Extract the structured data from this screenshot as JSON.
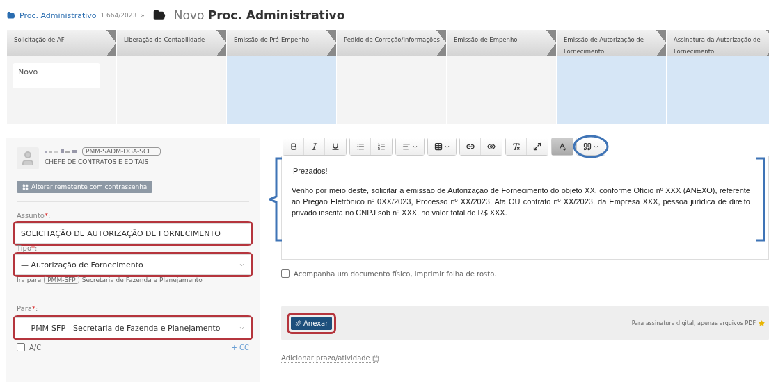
{
  "breadcrumb": {
    "link": "Proc. Administrativo",
    "number": "1.664/2023",
    "separator": "»"
  },
  "title": {
    "prefix": "Novo",
    "main": "Proc. Administrativo"
  },
  "stages": [
    {
      "label": "Solicitação de AF",
      "current": false,
      "cards": [
        "Novo"
      ]
    },
    {
      "label": "Liberação da Contabilidade",
      "current": false
    },
    {
      "label": "Emissão de Pré-Empenho",
      "current": true
    },
    {
      "label": "Pedido de Correção/Informações",
      "current": false
    },
    {
      "label": "Emissão de Empenho",
      "current": false
    },
    {
      "label": "Emissão de Autorização de Fornecimento",
      "current": true
    },
    {
      "label": "Assinatura da Autorização de Fornecimento",
      "current": true
    }
  ],
  "sender": {
    "unit": "PMM-SADM-DGA-SCL...",
    "role": "CHEFE DE CONTRATOS E EDITAIS",
    "change_button": "Alterar remetente com contrassenha"
  },
  "assunto": {
    "label": "Assunto",
    "required_mark": "*",
    "colon": ":",
    "value": "SOLICITAÇÃO DE AUTORIZAÇÃO DE FORNECIMENTO",
    "highlighted": true
  },
  "tipo": {
    "label": "Tipo",
    "required_mark": "*",
    "colon": ":",
    "value": "— Autorização de Fornecimento",
    "highlighted": true,
    "hint_prefix": "Ira para",
    "hint_tag": "PMM-SFP",
    "hint_text": "Secretaria de Fazenda e Planejamento"
  },
  "para": {
    "label": "Para",
    "required_mark": "*",
    "colon": ":",
    "value": "— PMM-SFP - Secretaria de Fazenda e Planejamento",
    "highlighted": true
  },
  "ac": {
    "label": "A/C",
    "checked": false
  },
  "cc_link": "+ CC",
  "toolbar_buttons": [
    {
      "active": false,
      "highlighted": false
    },
    {
      "active": false,
      "highlighted": false
    },
    {
      "active": false,
      "highlighted": false
    },
    {
      "active": false,
      "highlighted": false
    },
    {
      "active": false,
      "highlighted": false
    },
    {
      "active": false,
      "highlighted": false
    },
    {
      "active": false,
      "highlighted": false
    },
    {
      "active": false,
      "highlighted": false
    },
    {
      "active": false,
      "highlighted": false
    },
    {
      "active": false,
      "highlighted": false
    },
    {
      "active": false,
      "highlighted": false
    },
    {
      "active": true,
      "highlighted": false
    },
    {
      "active": false,
      "highlighted": true
    }
  ],
  "editor": {
    "highlighted": true,
    "paragraphs": [
      "Prezados!",
      "Venho por meio deste, solicitar a emissão de Autorização de Fornecimento do objeto XX, conforme Ofício nº XXX (ANEXO), referente ao Pregão Eletrônico nº 0XX/2023, Processo nº XX/2023, Ata OU contrato nº XX/2023, da Empresa XXX, pessoa jurídica de direito privado inscrita no CNPJ sob nº XXX, no valor total de R$ XXX."
    ]
  },
  "physical_doc": {
    "label": "Acompanha um documento físico, imprimir folha de rosto.",
    "checked": false
  },
  "attach": {
    "button": "Anexar",
    "highlighted": true,
    "note": "Para assinatura digital, apenas arquivos PDF"
  },
  "deadline_link": "Adicionar prazo/atividade"
}
